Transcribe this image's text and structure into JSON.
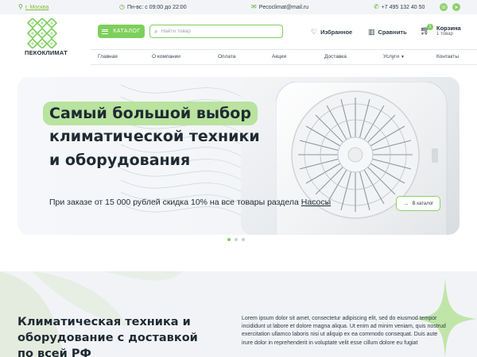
{
  "topbar": {
    "city": "г. Москва",
    "hours": "Пн-вс: с 09:00 до 22:00",
    "email": "Pecoclimat@mail.ru",
    "phone": "+7 495 132 40 50",
    "icons": [
      "location-pin-icon",
      "clock-icon",
      "mail-icon",
      "phone-icon",
      "whatsapp-icon",
      "telegram-icon"
    ]
  },
  "header": {
    "logo_text": "ПЕКОКЛИМАТ",
    "catalog_label": "КАТАЛОГ",
    "search_placeholder": "Найти товар",
    "favorites_label": "Избранное",
    "compare_label": "Сравнить",
    "cart_label": "Корзина",
    "cart_count_text": "1 товар",
    "cart_badge": "1"
  },
  "nav": {
    "items": [
      "Главная",
      "О компании",
      "Оплата",
      "Акции",
      "Доставка",
      "Услуги",
      "Контакты"
    ]
  },
  "hero": {
    "title_line1": "Самый большой выбор",
    "title_line2": "климатической техники",
    "title_line3": "и оборудования",
    "promo_text": "При заказе от 15 000 рублей скидка 10% на все товары раздела ",
    "promo_link": "Насосы",
    "catalog_link": "В каталог",
    "slides": 3,
    "active_slide": 1
  },
  "section": {
    "heading_line1": "Климатическая техника и",
    "heading_line2": "оборудование с доставкой",
    "heading_line3": "по всей РФ",
    "paragraph": "Lorem ipsum dolor sit amet, consectetur adipiscing elit, sed do eiusmod tempor incididunt ut labore et dolore magna aliqua. Ut enim ad minim veniam, quis nostrud exercitation ullamco laboris nisi ut aliquip ex ea commodo consequat. Duis aute irure dolor in reprehenderit in voluptate velit esse cillum dolore eu fugiat"
  },
  "colors": {
    "accent": "#7dcf5c",
    "accent_light": "#b9e39f",
    "text": "#1f2a33",
    "topbar_bg": "#f3f4f8"
  }
}
